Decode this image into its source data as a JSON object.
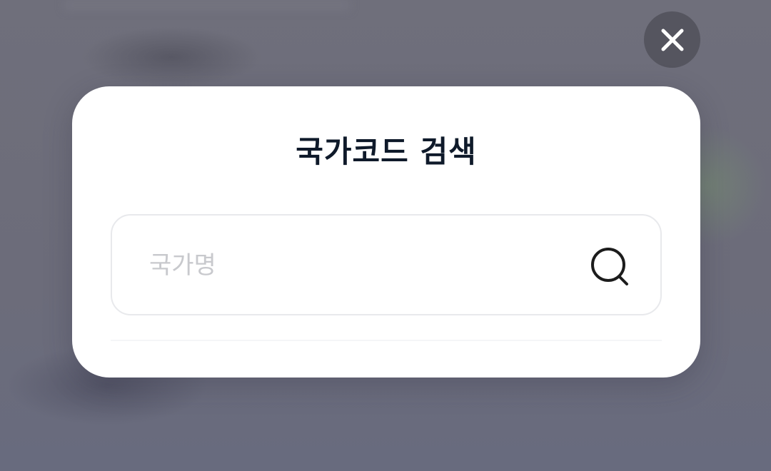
{
  "modal": {
    "title": "국가코드 검색",
    "search": {
      "placeholder": "국가명",
      "value": "",
      "icon": "search-icon"
    }
  },
  "close": {
    "icon": "close-icon"
  },
  "colors": {
    "overlay": "#6e6e7c",
    "close_bg": "#55555f",
    "title": "#0f1a2a",
    "placeholder": "#c8c9cd",
    "input_border": "#e8e9ec"
  }
}
